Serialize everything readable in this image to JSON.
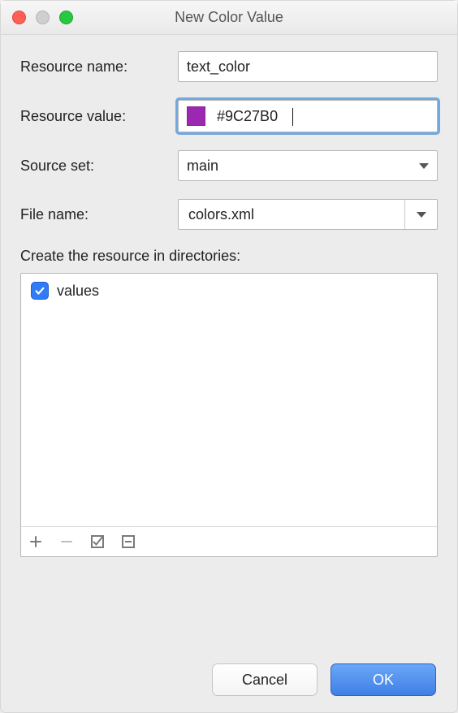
{
  "window": {
    "title": "New Color Value"
  },
  "form": {
    "resource_name_label": "Resource name:",
    "resource_name_value": "text_color",
    "resource_value_label": "Resource value:",
    "resource_value_value": "#9C27B0",
    "resource_value_swatch_color": "#9C27B0",
    "source_set_label": "Source set:",
    "source_set_value": "main",
    "file_name_label": "File name:",
    "file_name_value": "colors.xml"
  },
  "directories": {
    "label": "Create the resource in directories:",
    "items": [
      {
        "label": "values",
        "checked": true
      }
    ]
  },
  "buttons": {
    "cancel": "Cancel",
    "ok": "OK"
  }
}
